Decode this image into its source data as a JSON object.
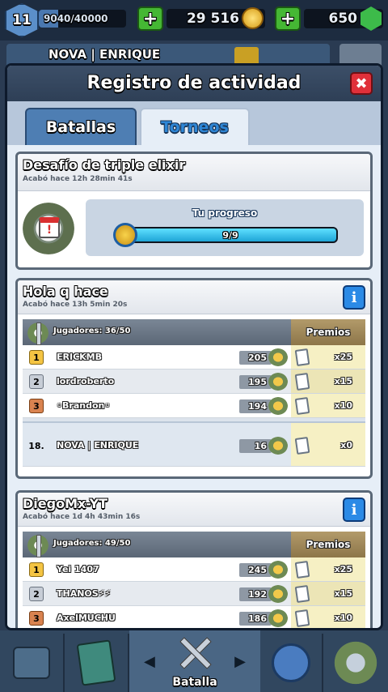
{
  "hud": {
    "level": "11",
    "xp": "9040/40000",
    "xp_progress": 0.226,
    "gold": "29 516",
    "gems": "650"
  },
  "clan_bar": {
    "name": "NOVA | ENRIQUE"
  },
  "modal": {
    "title": "Registro de actividad",
    "close": "✖",
    "tabs": [
      {
        "label": "Batallas",
        "active": false
      },
      {
        "label": "Torneos",
        "active": true
      }
    ]
  },
  "challenge": {
    "title": "Desafío de triple elixir",
    "ended": "Acabó hace 12h 28min 41s",
    "progress_label": "Tu progreso",
    "progress_text": "9/9",
    "progress_value": 1.0
  },
  "tournaments": [
    {
      "title": "Hola q hace",
      "ended": "Acabó hace 13h 5min 20s",
      "players": "Jugadores: 36/50",
      "prizes_header": "Premios",
      "rows": [
        {
          "rank": "1",
          "name": "ERICKMB",
          "score": "205",
          "prize": "x25"
        },
        {
          "rank": "2",
          "name": "lordroberto",
          "score": "195",
          "prize": "x15"
        },
        {
          "rank": "3",
          "name": "◦Brandon◦",
          "score": "194",
          "prize": "x10"
        }
      ],
      "me": {
        "rank": "18.",
        "name": "NOVA | ENRIQUE",
        "score": "16",
        "prize": "x0"
      }
    },
    {
      "title": "DiegoMx-YT",
      "ended": "Acabó hace 1d 4h 43min 16s",
      "players": "Jugadores: 49/50",
      "prizes_header": "Premios",
      "rows": [
        {
          "rank": "1",
          "name": "Yei 1407",
          "score": "245",
          "prize": "x25"
        },
        {
          "rank": "2",
          "name": "THANOS⚡⚡",
          "score": "192",
          "prize": "x15"
        },
        {
          "rank": "3",
          "name": "AxelMUCHU",
          "score": "186",
          "prize": "x10"
        }
      ]
    }
  ],
  "bottom_nav": {
    "battle_label": "Batalla",
    "left_chevron": "◀",
    "right_chevron": "▶"
  },
  "colors": {
    "accent_blue": "#2e86d6",
    "close_red": "#e0303a",
    "plus_green": "#45b734",
    "progress_cyan": "#1ea4d6"
  }
}
